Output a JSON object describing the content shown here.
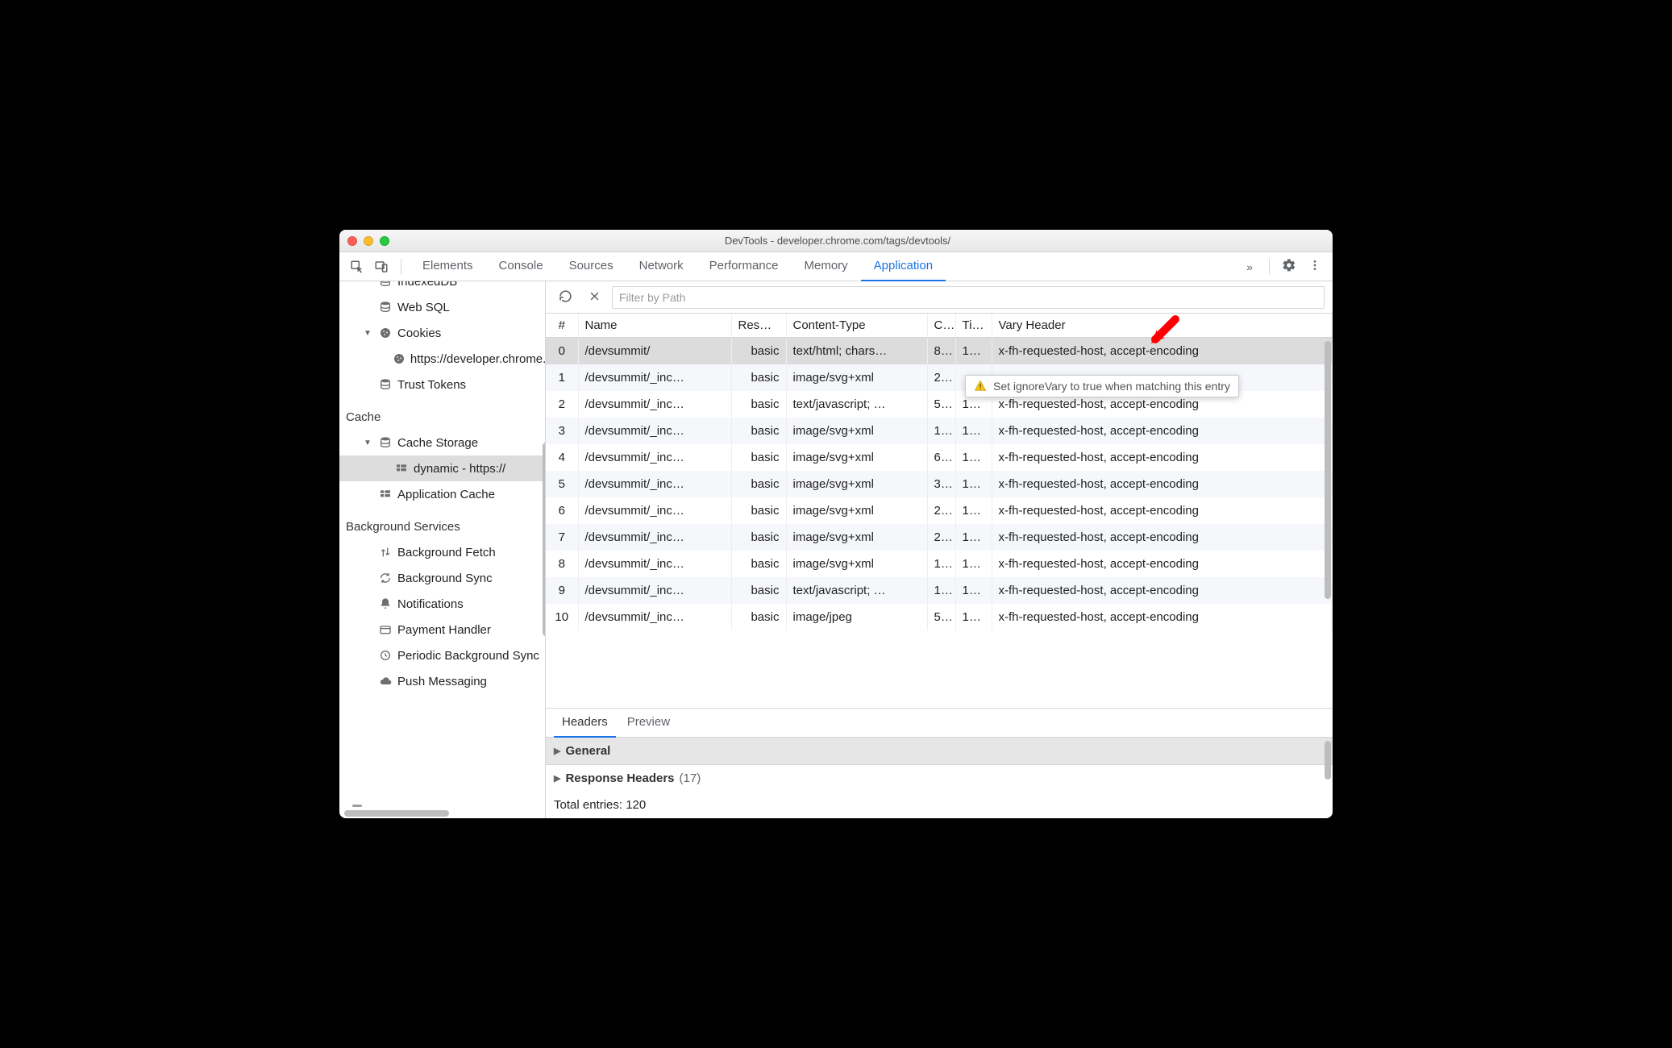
{
  "window": {
    "title": "DevTools - developer.chrome.com/tags/devtools/"
  },
  "tabs": {
    "items": [
      "Elements",
      "Console",
      "Sources",
      "Network",
      "Performance",
      "Memory",
      "Application"
    ],
    "active": "Application",
    "overflow": "»"
  },
  "sidebar": {
    "items_top": [
      {
        "label": "IndexedDB",
        "icon": "db"
      },
      {
        "label": "Web SQL",
        "icon": "db"
      },
      {
        "label": "Cookies",
        "icon": "cookie",
        "expandable": true,
        "expanded": true
      },
      {
        "label": "https://developer.chrome.com",
        "icon": "cookie",
        "child": true
      },
      {
        "label": "Trust Tokens",
        "icon": "db"
      }
    ],
    "cache_section": "Cache",
    "cache_items": [
      {
        "label": "Cache Storage",
        "icon": "db",
        "expandable": true,
        "expanded": true
      },
      {
        "label": "dynamic - https://",
        "icon": "grid",
        "child": true,
        "selected": true
      },
      {
        "label": "Application Cache",
        "icon": "grid"
      }
    ],
    "bg_section": "Background Services",
    "bg_items": [
      {
        "label": "Background Fetch",
        "icon": "updown"
      },
      {
        "label": "Background Sync",
        "icon": "sync"
      },
      {
        "label": "Notifications",
        "icon": "bell"
      },
      {
        "label": "Payment Handler",
        "icon": "card"
      },
      {
        "label": "Periodic Background Sync",
        "icon": "clock"
      },
      {
        "label": "Push Messaging",
        "icon": "cloud"
      }
    ]
  },
  "toolbar": {
    "filter_placeholder": "Filter by Path"
  },
  "table": {
    "headers": {
      "num": "#",
      "name": "Name",
      "response": "Res…",
      "content_type": "Content-Type",
      "content_length": "C..",
      "time": "Ti…",
      "vary": "Vary Header"
    },
    "rows": [
      {
        "num": "0",
        "name": "/devsummit/",
        "res": "basic",
        "ct": "text/html; chars…",
        "c": "8…",
        "t": "1…",
        "vary": "x-fh-requested-host, accept-encoding",
        "selected": true
      },
      {
        "num": "1",
        "name": "/devsummit/_inc…",
        "res": "basic",
        "ct": "image/svg+xml",
        "c": "2…",
        "t": "",
        "vary": ""
      },
      {
        "num": "2",
        "name": "/devsummit/_inc…",
        "res": "basic",
        "ct": "text/javascript; …",
        "c": "5…",
        "t": "1…",
        "vary": "x-fh-requested-host, accept-encoding"
      },
      {
        "num": "3",
        "name": "/devsummit/_inc…",
        "res": "basic",
        "ct": "image/svg+xml",
        "c": "1…",
        "t": "1…",
        "vary": "x-fh-requested-host, accept-encoding"
      },
      {
        "num": "4",
        "name": "/devsummit/_inc…",
        "res": "basic",
        "ct": "image/svg+xml",
        "c": "6…",
        "t": "1…",
        "vary": "x-fh-requested-host, accept-encoding"
      },
      {
        "num": "5",
        "name": "/devsummit/_inc…",
        "res": "basic",
        "ct": "image/svg+xml",
        "c": "3…",
        "t": "1…",
        "vary": "x-fh-requested-host, accept-encoding"
      },
      {
        "num": "6",
        "name": "/devsummit/_inc…",
        "res": "basic",
        "ct": "image/svg+xml",
        "c": "2…",
        "t": "1…",
        "vary": "x-fh-requested-host, accept-encoding"
      },
      {
        "num": "7",
        "name": "/devsummit/_inc…",
        "res": "basic",
        "ct": "image/svg+xml",
        "c": "2…",
        "t": "1…",
        "vary": "x-fh-requested-host, accept-encoding"
      },
      {
        "num": "8",
        "name": "/devsummit/_inc…",
        "res": "basic",
        "ct": "image/svg+xml",
        "c": "1…",
        "t": "1…",
        "vary": "x-fh-requested-host, accept-encoding"
      },
      {
        "num": "9",
        "name": "/devsummit/_inc…",
        "res": "basic",
        "ct": "text/javascript; …",
        "c": "1…",
        "t": "1…",
        "vary": "x-fh-requested-host, accept-encoding"
      },
      {
        "num": "10",
        "name": "/devsummit/_inc…",
        "res": "basic",
        "ct": "image/jpeg",
        "c": "5…",
        "t": "1…",
        "vary": "x-fh-requested-host, accept-encoding"
      }
    ]
  },
  "tooltip": {
    "text": "Set ignoreVary to true when matching this entry"
  },
  "details": {
    "tabs": [
      "Headers",
      "Preview"
    ],
    "active": "Headers",
    "sections": {
      "general": "General",
      "response_headers": "Response Headers",
      "response_headers_count": "(17)"
    },
    "total": "Total entries: 120"
  }
}
